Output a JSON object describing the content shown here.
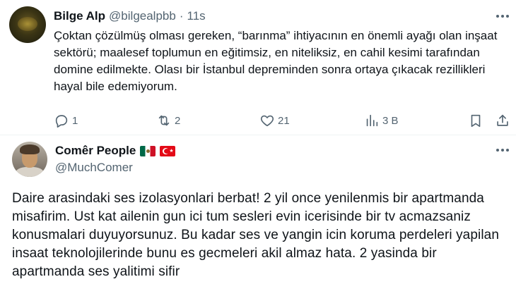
{
  "tweet1": {
    "author_name": "Bilge Alp",
    "handle": "@bilgealpbb",
    "separator": "·",
    "time": "11s",
    "text": "Çoktan çözülmüş olması gereken, “barınma” ihtiyacının en önemli ayağı olan inşaat sektörü; maalesef toplumun en eğitimsiz, en niteliksiz, en cahil kesimi tarafından domine edilmekte. Olası bir İstanbul depreminden sonra ortaya çıkacak rezillikleri hayal bile edemiyorum.",
    "actions": {
      "reply_count": "1",
      "repost_count": "2",
      "like_count": "21",
      "views_count": "3 B"
    },
    "icons": [
      "more-icon",
      "reply-icon",
      "repost-icon",
      "like-icon",
      "views-icon",
      "bookmark-icon",
      "share-icon"
    ]
  },
  "tweet2": {
    "author_name": "Comêr People",
    "flags": [
      "mexico-flag",
      "turkey-flag"
    ],
    "handle": "@MuchComer",
    "text": "Daire arasindaki ses izolasyonlari berbat! 2 yil once yenilenmis bir apartmanda misafirim. Ust kat ailenin gun ici tum sesleri evin icerisinde bir tv acmazsaniz konusmalari duyuyorsunuz. Bu kadar ses ve yangin icin koruma perdeleri yapilan insaat teknolojilerinde bunu es gecmeleri akil almaz hata. 2 yasinda bir apartmanda ses yalitimi sifir"
  }
}
